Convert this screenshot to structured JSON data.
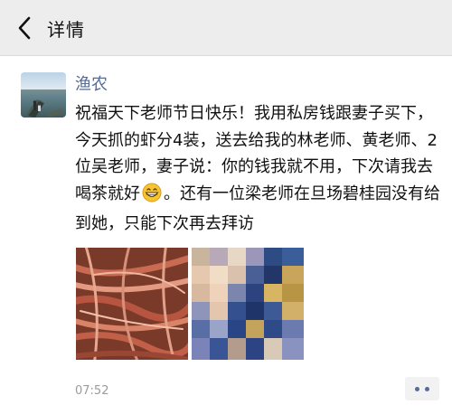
{
  "navbar": {
    "title": "详情",
    "back_icon": "chevron-left-icon"
  },
  "post": {
    "author": "渔农",
    "avatar_icon": "avatar-photo-boat-on-water",
    "text_before_emoji": "祝福天下老师节日快乐！我用私房钱跟妻子买下，今天抓的虾分4装，送去给我的林老师、黄老师、2位吴老师，妻子说：你的钱我就不用，下次请我去喝茶就好",
    "emoji": "grinning-face-emoji",
    "text_after_emoji": "。还有一位梁老师在旦场碧桂园没有给到她，只能下次再去拜访",
    "photos": [
      {
        "subject": "shrimp-photo"
      },
      {
        "subject": "blurred-photo"
      }
    ],
    "time": "07:52",
    "more_icon": "more-dots-icon"
  },
  "colors": {
    "link": "#576b95",
    "navbar_bg": "#ededed",
    "timestamp": "#9b9b9b"
  }
}
